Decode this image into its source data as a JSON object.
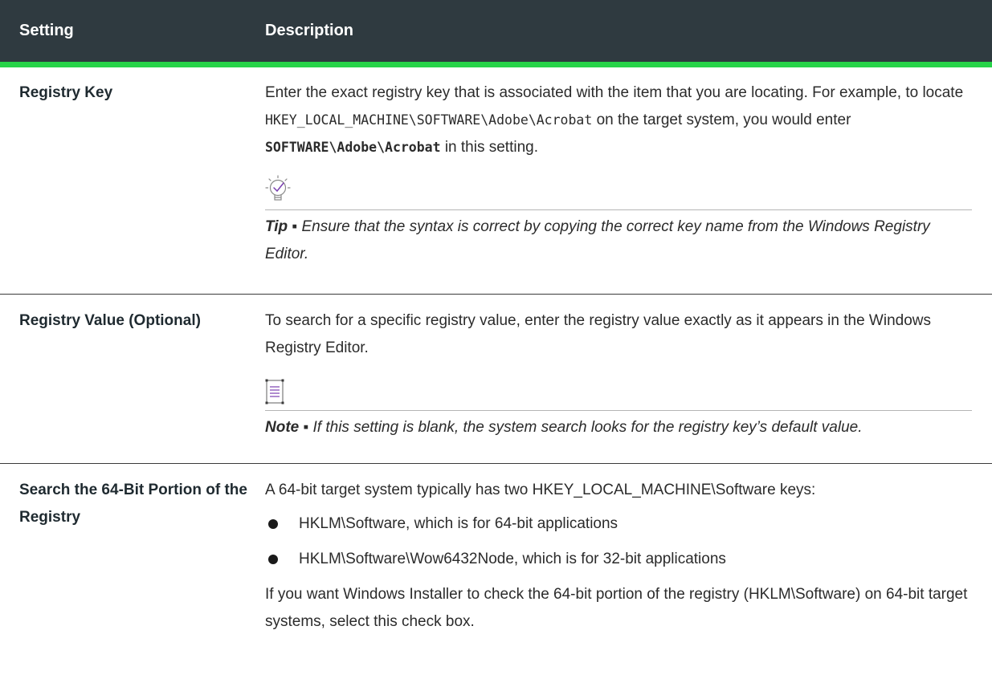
{
  "header": {
    "col_setting": "Setting",
    "col_description": "Description"
  },
  "rows": [
    {
      "setting": "Registry Key",
      "desc_part1": "Enter the exact registry key that is associated with the item that you are locating. For example, to locate ",
      "desc_code": "HKEY_LOCAL_MACHINE\\SOFTWARE\\Adobe\\Acrobat",
      "desc_part2": " on the target system, you would enter ",
      "desc_code_bold": "SOFTWARE\\Adobe\\Acrobat",
      "desc_part3": " in this setting.",
      "callout_icon": "lightbulb-check-icon",
      "callout_label": "Tip ▪",
      "callout_text": " Ensure that the syntax is correct by copying the correct key name from the Windows Registry Editor."
    },
    {
      "setting": "Registry Value (Optional)",
      "desc": "To search for a specific registry value, enter the registry value exactly as it appears in the Windows Registry Editor.",
      "callout_icon": "note-icon",
      "callout_label": "Note ▪",
      "callout_text": " If this setting is blank, the system search looks for the registry key’s default value."
    },
    {
      "setting": "Search the 64-Bit Portion of the Registry",
      "desc_intro": "A 64-bit target system typically has two HKEY_LOCAL_MACHINE\\Software keys:",
      "bullets": [
        "HKLM\\Software, which is for 64-bit applications",
        "HKLM\\Software\\Wow6432Node, which is for 32-bit applications"
      ],
      "desc_outro": "If you want Windows Installer to check the 64-bit portion of the registry (HKLM\\Software) on 64-bit target systems, select this check box."
    }
  ],
  "colors": {
    "header_bg": "#2f3a40",
    "header_accent": "#27d349",
    "tip_icon": "#7a3fb0",
    "note_icon": "#7a3fb0"
  }
}
